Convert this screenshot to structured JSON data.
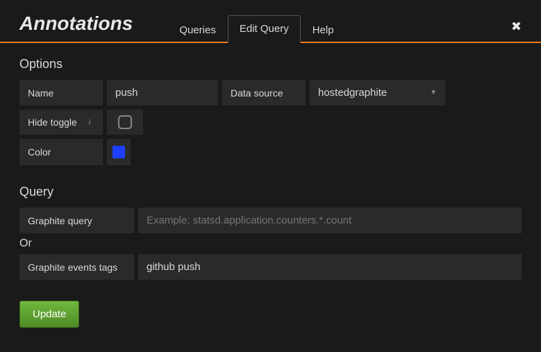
{
  "header": {
    "title": "Annotations",
    "tabs": [
      {
        "label": "Queries",
        "active": false
      },
      {
        "label": "Edit Query",
        "active": true
      },
      {
        "label": "Help",
        "active": false
      }
    ]
  },
  "options": {
    "section_title": "Options",
    "name_label": "Name",
    "name_value": "push",
    "datasource_label": "Data source",
    "datasource_value": "hostedgraphite",
    "hide_toggle_label": "Hide toggle",
    "hide_toggle_checked": false,
    "color_label": "Color",
    "color_value": "#1f3fff"
  },
  "query": {
    "section_title": "Query",
    "graphite_query_label": "Graphite query",
    "graphite_query_value": "",
    "graphite_query_placeholder": "Example: statsd.application.counters.*.count",
    "or_label": "Or",
    "events_tags_label": "Graphite events tags",
    "events_tags_value": "github push"
  },
  "actions": {
    "update_label": "Update"
  }
}
